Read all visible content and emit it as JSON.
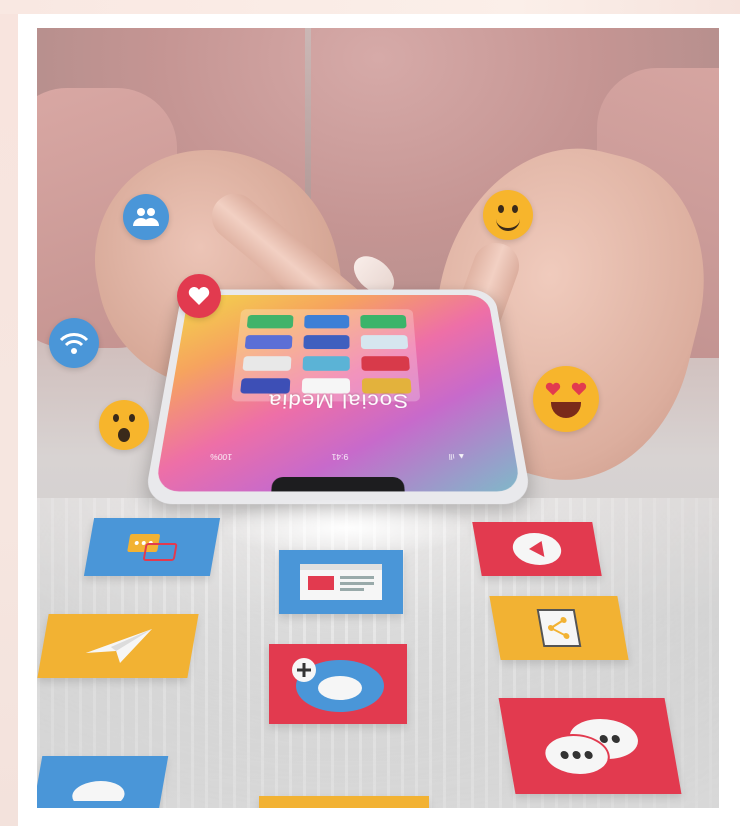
{
  "screen": {
    "title": "Social Media",
    "status": [
      "100%",
      "9:41",
      "▲ ıll"
    ],
    "app_tile_colors": [
      "#41b36a",
      "#3d7fd6",
      "#3bb46a",
      "#5b6fd6",
      "#3f5fbf",
      "#d6e6ef",
      "#e8e8e8",
      "#5bb3d6",
      "#d83a4a",
      "#3d4fb6",
      "#f6f6f6",
      "#e3b23c"
    ]
  },
  "bubbles": {
    "people": {
      "color": "#4a96d8",
      "icon": "group-icon"
    },
    "heart": {
      "color": "#e23a4f",
      "icon": "heart-icon"
    },
    "wifi": {
      "color": "#4a96d8",
      "icon": "wifi-icon"
    },
    "smile": {
      "color": "#f7b52c",
      "icon": "smile-emoji-icon"
    },
    "love": {
      "color": "#f7b52c",
      "icon": "heart-eyes-emoji-icon"
    },
    "surprised": {
      "color": "#f7b52c",
      "icon": "surprised-emoji-icon"
    }
  },
  "tiles": {
    "messages": {
      "color": "#4a96d8",
      "icon": "chat-cards-icon"
    },
    "browser": {
      "color": "#4a96d8",
      "icon": "web-window-icon"
    },
    "video": {
      "color": "#e23a4f",
      "icon": "play-icon"
    },
    "send": {
      "color": "#f2b233",
      "icon": "paper-plane-icon"
    },
    "gallery": {
      "color": "#f2b233",
      "icon": "share-photo-icon"
    },
    "add": {
      "color": "#e23a4f",
      "icon": "add-user-icon"
    },
    "chat": {
      "color": "#e23a4f",
      "icon": "speech-bubbles-icon"
    },
    "partial": {
      "color": "#4a96d8",
      "icon": "partial-tile-icon"
    }
  }
}
